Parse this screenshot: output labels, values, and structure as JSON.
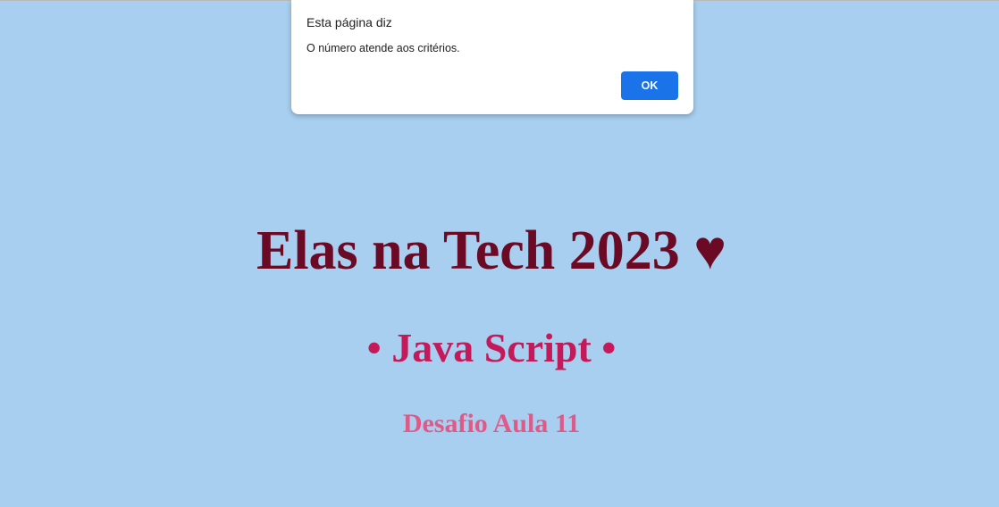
{
  "page": {
    "title": "Elas na Tech 2023 ♥",
    "subtitle": "• Java Script •",
    "tagline": "Desafio Aula 11"
  },
  "alert": {
    "title": "Esta página diz",
    "message": "O número atende aos critérios.",
    "ok_label": "OK"
  },
  "colors": {
    "background": "#a8cfef",
    "title": "#6b0a25",
    "subtitle": "#c41a5a",
    "tagline": "#e05a88",
    "button": "#1a73e8"
  }
}
